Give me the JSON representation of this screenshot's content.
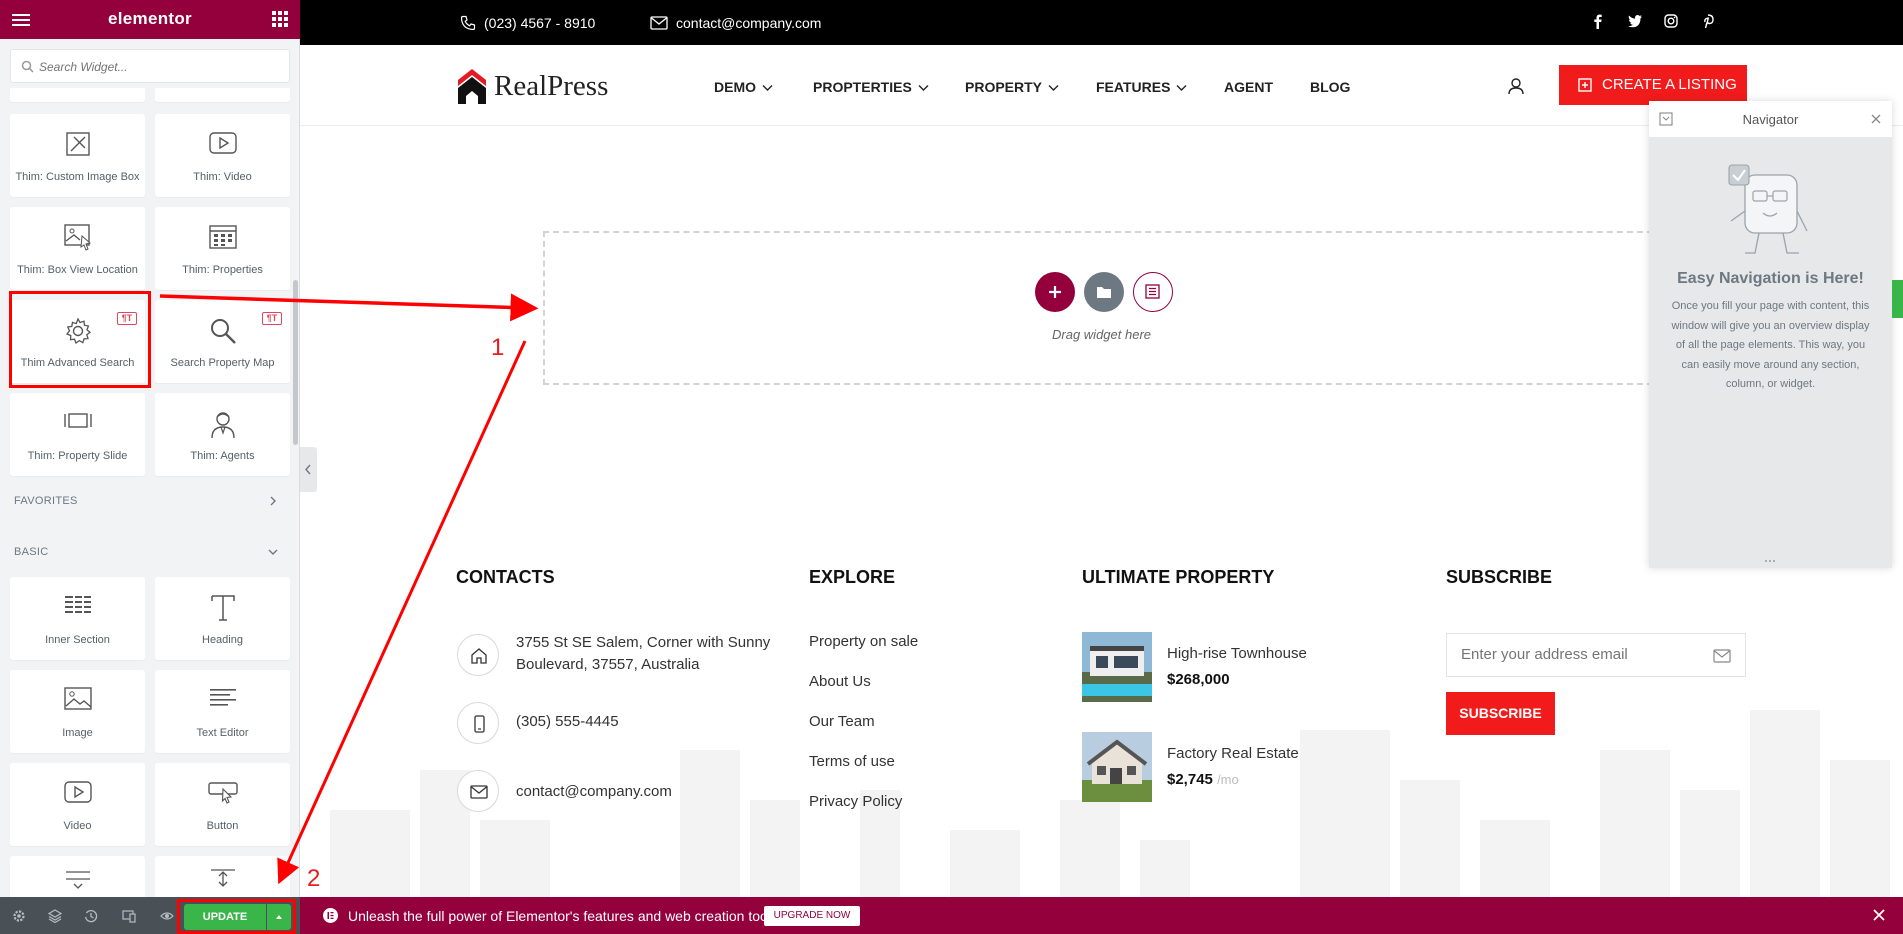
{
  "editor": {
    "brand": "elementor",
    "search_placeholder": "Search Widget...",
    "widgets_theme": [
      {
        "label": "Thim: Custom Image Box",
        "icon": "custom-image-box-icon"
      },
      {
        "label": "Thim: Video",
        "icon": "video-icon"
      },
      {
        "label": "Thim: Box View Location",
        "icon": "box-view-location-icon"
      },
      {
        "label": "Thim: Properties",
        "icon": "properties-icon"
      },
      {
        "label": "Thim Advanced Search",
        "icon": "gear-icon",
        "pro": true
      },
      {
        "label": "Search Property Map",
        "icon": "search-icon",
        "pro": true
      },
      {
        "label": "Thim: Property Slide",
        "icon": "slide-icon"
      },
      {
        "label": "Thim: Agents",
        "icon": "agent-icon"
      }
    ],
    "favorites_label": "FAVORITES",
    "basic_label": "BASIC",
    "widgets_basic": [
      {
        "label": "Inner Section",
        "icon": "inner-section-icon"
      },
      {
        "label": "Heading",
        "icon": "heading-icon"
      },
      {
        "label": "Image",
        "icon": "image-icon"
      },
      {
        "label": "Text Editor",
        "icon": "text-editor-icon"
      },
      {
        "label": "Video",
        "icon": "video-icon"
      },
      {
        "label": "Button",
        "icon": "button-icon"
      }
    ],
    "update_label": "UPDATE",
    "pro_badge": "¶T",
    "accent": "#93003c"
  },
  "site": {
    "phone": "(023) 4567 - 8910",
    "email": "contact@company.com",
    "logo_text": "RealPress",
    "nav": [
      "DEMO",
      "PROPTERTIES",
      "PROPERTY",
      "FEATURES",
      "AGENT",
      "BLOG"
    ],
    "cta": "CREATE A LISTING",
    "drag_text": "Drag widget here",
    "brand_red": "#f21b1b"
  },
  "footer": {
    "contacts_title": "CONTACTS",
    "address_line1": "3755 St SE Salem, Corner with Sunny",
    "address_line2": "Boulevard, 37557, Australia",
    "phone": "(305) 555-4445",
    "email": "contact@company.com",
    "explore_title": "EXPLORE",
    "explore_links": [
      "Property on sale",
      "About Us",
      "Our Team",
      "Terms of use",
      "Privacy Policy"
    ],
    "ultimate_title": "ULTIMATE PROPERTY",
    "properties": [
      {
        "name": "High-rise Townhouse",
        "price": "$268,000",
        "suffix": ""
      },
      {
        "name": "Factory Real Estate",
        "price": "$2,745",
        "suffix": "/mo"
      }
    ],
    "subscribe_title": "SUBSCRIBE",
    "email_placeholder": "Enter your address email",
    "subscribe_btn": "SUBSCRIBE"
  },
  "navigator": {
    "title": "Navigator",
    "heading": "Easy Navigation is Here!",
    "body": "Once you fill your page with content, this window will give you an overview display of all the page elements. This way, you can easily move around any section, column, or widget."
  },
  "promo": {
    "message": "Unleash the full power of Elementor's features and web creation tools.",
    "button": "UPGRADE NOW"
  },
  "annotations": {
    "step1": "1",
    "step2": "2"
  }
}
